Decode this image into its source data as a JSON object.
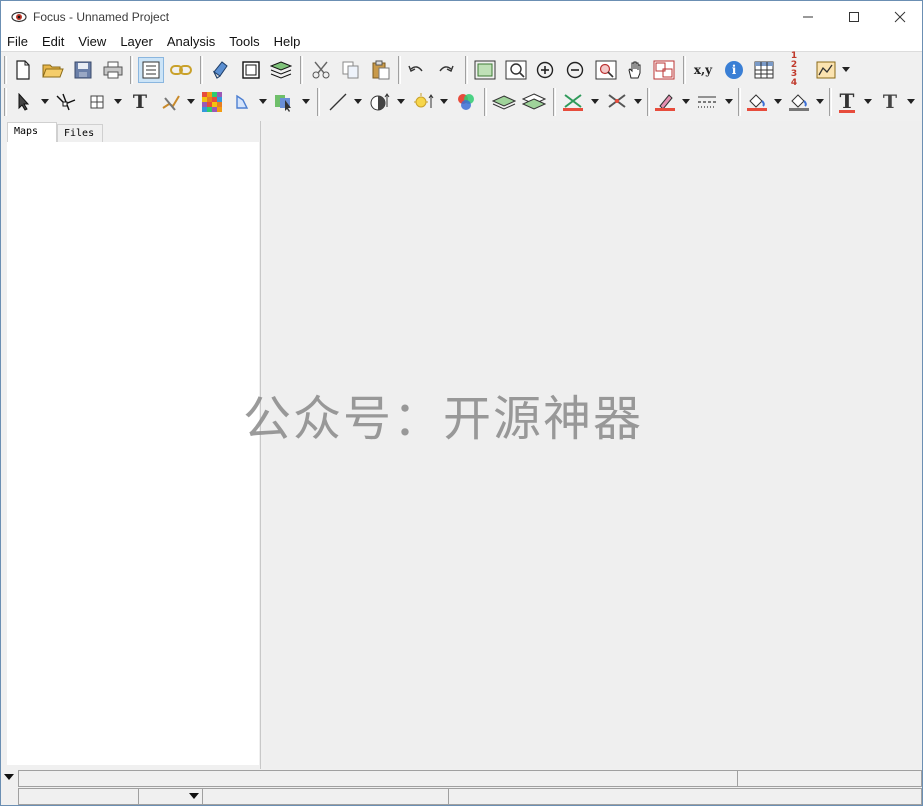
{
  "window": {
    "title": "Focus - Unnamed Project",
    "app_icon": "eye-icon",
    "controls": [
      "minimize-icon",
      "maximize-icon",
      "close-icon"
    ]
  },
  "menu": [
    "File",
    "Edit",
    "View",
    "Layer",
    "Analysis",
    "Tools",
    "Help"
  ],
  "toolbar1": {
    "buttons": [
      "new-document-icon",
      "open-folder-icon",
      "save-icon",
      "print-icon",
      "layer-list-icon",
      "link-chain-icon",
      "edit-eraser-icon",
      "frame-icon",
      "layers-stack-icon",
      "cut-icon",
      "copy-icon",
      "paste-icon",
      "undo-icon",
      "redo-icon",
      "zoom-extent-icon",
      "zoom-window-icon",
      "zoom-in-icon",
      "zoom-out-icon",
      "zoom-selection-icon",
      "pan-hand-icon",
      "overview-map-icon",
      "xy-coordinates-icon",
      "info-icon",
      "attribute-table-icon",
      "numbering-icon",
      "chart-icon"
    ],
    "xy_label": "x,y",
    "numbering_label": "1 2 3 4",
    "info_label": "i"
  },
  "toolbar2": {
    "buttons": [
      "select-arrow-icon",
      "vertex-edit-icon",
      "grid-icon",
      "text-tool-icon",
      "line-measure-icon",
      "raster-grid-icon",
      "polygon-icon",
      "select-feature-icon",
      "draw-line-icon",
      "transparency-icon",
      "light-icon",
      "color-circles-icon",
      "layer-up-icon",
      "layer-down-icon",
      "point-symbol-icon",
      "point-style-icon",
      "pen-color-icon",
      "line-style-icon",
      "fill-color-icon",
      "fill-style-icon",
      "font-bold-icon",
      "font-icon"
    ],
    "text_label": "T"
  },
  "left_pane": {
    "tabs": [
      {
        "label": "Maps",
        "active": true
      },
      {
        "label": "Files",
        "active": false
      }
    ]
  },
  "map": {
    "watermark": "公众号：开源神器"
  },
  "statusbar": {
    "row1": [
      "",
      ""
    ],
    "row2": [
      "",
      "",
      "",
      ""
    ]
  },
  "colors": {
    "accent": "#cce4f7",
    "window_border": "#6b8fb3",
    "map_bg": "#efefef"
  }
}
